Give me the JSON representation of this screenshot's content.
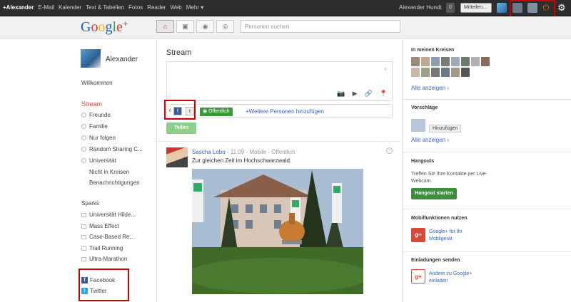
{
  "topbar": {
    "me": "+Alexander",
    "links": [
      "E-Mail",
      "Kalender",
      "Text & Tabellen",
      "Fotos",
      "Reader",
      "Web",
      "Mehr ▾"
    ],
    "username": "Alexander Hundt",
    "notification_count": "0",
    "share_placeholder": "Mitteilen..."
  },
  "header": {
    "search_placeholder": "Personen suchen"
  },
  "left": {
    "name": "Alexander",
    "welcome": "Willkommen",
    "stream": "Stream",
    "circles": [
      "Freunde",
      "Familie",
      "Nur folgen",
      "Random Sharing C...",
      "Universität"
    ],
    "not_in_circles": "Nicht in Kreisen",
    "notifications": "Benachrichtigungen",
    "sparks_title": "Sparks",
    "sparks": [
      "Universität Hilde...",
      "Mass Effect",
      "Case-Based Re...",
      "Trail Running",
      "Ultra-Marathon"
    ],
    "facebook": "Facebook",
    "twitter": "Twitter"
  },
  "center": {
    "title": "Stream",
    "close": "×",
    "count": "0",
    "public_label": "Öffentlich",
    "add_people": "Weitere Personen hinzufügen",
    "share_button": "Teilen",
    "post": {
      "author": "Sascha Lobo",
      "time": "11:09",
      "via": "Mobile",
      "visibility": "Öffentlich",
      "text": "Zur gleichen Zeit im Hochschwarzwald."
    }
  },
  "right": {
    "circles_title": "In meinen Kreisen",
    "show_all": "Alle anzeigen ›",
    "suggestions_title": "Vorschläge",
    "add_button": "Hinzufügen",
    "show_all_2": "Alle anzeigen ›",
    "hangouts_title": "Hangouts",
    "hangouts_text": "Treffen Sie Ihre Kontakte per Live-Webcam.",
    "hangout_button": "Hangout starten",
    "mobile_title": "Mobilfunktionen nutzen",
    "mobile_link": "Google+ für Ihr Mobilgerät",
    "invite_title": "Einladungen senden",
    "invite_link": "Andere zu Google+ einladen"
  }
}
